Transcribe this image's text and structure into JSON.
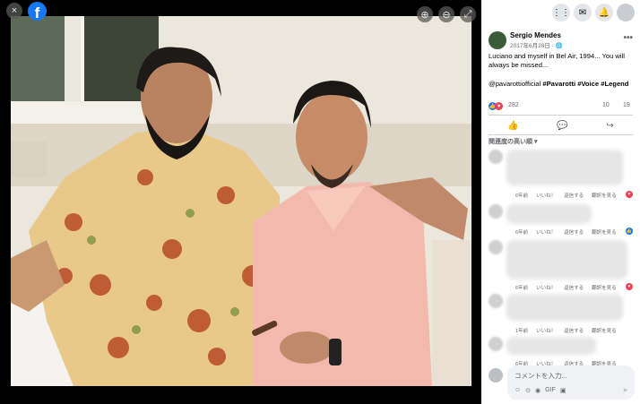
{
  "viewer": {
    "close_icon": "×",
    "brand_letter": "f",
    "zoom_in_icon": "⊕",
    "zoom_out_icon": "⊖",
    "fullscreen_icon": "⤢"
  },
  "topbar_icons": {
    "menu": "⋮⋮",
    "messenger": "✉",
    "notifications": "🔔",
    "profile": ""
  },
  "post": {
    "author": "Sergio Mendes",
    "date": "2017年6月28日 · ",
    "privacy_icon": "🌐",
    "more": "•••",
    "text": "Luciano and myself in Bel Air, 1994... You will always be missed...",
    "mention": "@pavarottiofficial",
    "hashtags": "#Pavarotti #Voice #Legend",
    "reaction_count": "282",
    "comment_count": "10",
    "share_count": "19"
  },
  "actions": {
    "like_icon": "👍",
    "comment_icon": "💬",
    "share_icon": "↪"
  },
  "comments": {
    "sort_label": "関連度の高い順 ▾",
    "items": [
      {
        "time": "6年前",
        "like": "いいね！",
        "reply": "返信する",
        "translate": "翻訳を見る",
        "reaction": "♥",
        "reaction_color": "#f33e58"
      },
      {
        "time": "6年前",
        "like": "いいね！",
        "reply": "返信する",
        "translate": "翻訳を見る",
        "reaction": "👍",
        "reaction_color": "#1877f2"
      },
      {
        "time": "6年前",
        "like": "いいね！",
        "reply": "返信する",
        "translate": "翻訳を見る",
        "reaction": "♥",
        "reaction_color": "#f33e58"
      },
      {
        "time": "1年前",
        "like": "いいね！",
        "reply": "返信する",
        "translate": "翻訳を見る",
        "reaction": "",
        "reaction_color": ""
      },
      {
        "time": "6年前",
        "like": "いいね！",
        "reply": "返信する",
        "translate": "翻訳を見る",
        "reaction": "",
        "reaction_color": ""
      }
    ]
  },
  "composer": {
    "placeholder": "コメントを入力...",
    "send_icon": "➤",
    "tool_icons": [
      "☺",
      "⊙",
      "◉",
      "GIF",
      "▣"
    ]
  }
}
